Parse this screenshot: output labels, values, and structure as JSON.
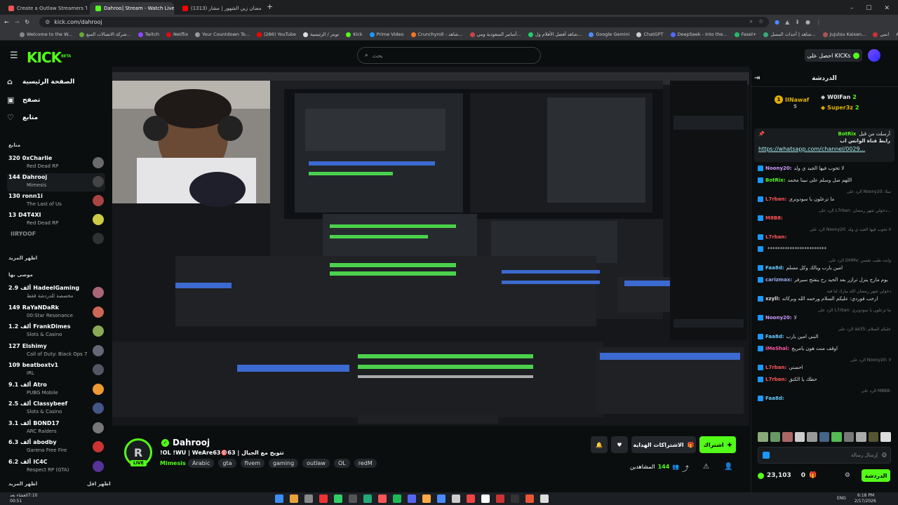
{
  "browser": {
    "tabs": [
      {
        "title": "Create a Outlaw Streamers Tier",
        "color": "#e55",
        "active": false
      },
      {
        "title": "Dahroo] Stream - Watch Live o",
        "color": "#53fc18",
        "active": true
      },
      {
        "title": "(1313) رمضان زين الشهور | مشار",
        "color": "#ff0000",
        "active": false
      }
    ],
    "new_tab": "+",
    "url": "kick.com/dahrooj",
    "bookmarks": [
      {
        "label": "Welcome to the W...",
        "color": "#888"
      },
      {
        "label": "شركة الاتصالات السع...",
        "color": "#6a3"
      },
      {
        "label": "Twitch",
        "color": "#9146ff"
      },
      {
        "label": "Netflix",
        "color": "#e50914"
      },
      {
        "label": "Your Countdown To...",
        "color": "#999"
      },
      {
        "label": "(286) YouTube",
        "color": "#ff0000"
      },
      {
        "label": "تويتر / الرئيسية",
        "color": "#ddd"
      },
      {
        "label": "Kick",
        "color": "#53fc18"
      },
      {
        "label": "Prime Video",
        "color": "#1a98ff"
      },
      {
        "label": "Crunchyroll - شاهد...",
        "color": "#f47521"
      },
      {
        "label": "أساتير السعودية ومي...",
        "color": "#c44"
      },
      {
        "label": "شاهد أفضل الأفلام ول...",
        "color": "#2c6"
      },
      {
        "label": "Google Gemini",
        "color": "#4a8cff"
      },
      {
        "label": "ChatGPT",
        "color": "#ccc"
      },
      {
        "label": "DeepSeek - Into the...",
        "color": "#4d6bfe"
      },
      {
        "label": "Fasel+",
        "color": "#2b6"
      },
      {
        "label": "شاهد | أحداث المسل...",
        "color": "#3a7"
      },
      {
        "label": "Jujutsu Kaisen...",
        "color": "#a55"
      },
      {
        "label": "انمي",
        "color": "#c33"
      }
    ],
    "all_bookmarks": "All Bookmarks"
  },
  "header": {
    "logo": "KICK",
    "logo_beta": "BETA",
    "search_placeholder": "بحث",
    "get_kicks": "احصل على KICKs"
  },
  "sidebar": {
    "nav": [
      {
        "label": "الصفحة الرئيسية",
        "icon": "home-icon"
      },
      {
        "label": "تصفح",
        "icon": "browse-icon"
      },
      {
        "label": "متابع",
        "icon": "heart-icon"
      }
    ],
    "following_header": "متابع",
    "following": [
      {
        "viewers": "320",
        "name": "0xCharlie",
        "game": "Red Dead RP",
        "color": "#6b6b6b"
      },
      {
        "viewers": "144",
        "name": "Dahrooj",
        "game": "Mimesis",
        "color": "#444"
      },
      {
        "viewers": "130",
        "name": "ronn1i",
        "game": "The Last of Us",
        "color": "#a44"
      },
      {
        "viewers": "13",
        "name": "D4T4XI",
        "game": "Red Dead RP",
        "color": "#cc4"
      },
      {
        "viewers": "",
        "name": "IIRYOOF",
        "game": "",
        "color": "#555"
      }
    ],
    "show_more_1": "اظهر المزيد",
    "recommended_header": "موصى بها",
    "recommended": [
      {
        "viewers": "2.9 ألف",
        "name": "HadeelGaming",
        "game": "مخصصة للدردشة فقط",
        "color": "#a67"
      },
      {
        "viewers": "149",
        "name": "RaYaNDaRk",
        "game": "00:Star Resonance",
        "color": "#c65"
      },
      {
        "viewers": "1.2 ألف",
        "name": "FrankDimes",
        "game": "Slots & Casino",
        "color": "#8a5"
      },
      {
        "viewers": "127",
        "name": "Elshimy",
        "game": "Call of Duty: Black Ops 7",
        "color": "#667"
      },
      {
        "viewers": "109",
        "name": "beatboxtv1",
        "game": "IRL",
        "color": "#556"
      },
      {
        "viewers": "9.1 ألف",
        "name": "Atro",
        "game": "PUBG Mobile",
        "color": "#e93"
      },
      {
        "viewers": "2.5 ألف",
        "name": "Classybeef",
        "game": "Slots & Casino",
        "color": "#458"
      },
      {
        "viewers": "3.1 ألف",
        "name": "BOND17",
        "game": "ARC Raiders",
        "color": "#777"
      },
      {
        "viewers": "6.3 ألف",
        "name": "abodby",
        "game": "Garena Free Fire",
        "color": "#c33"
      },
      {
        "viewers": "6.2 ألف",
        "name": "IC4C",
        "game": "Respect RP (GTA)",
        "color": "#539"
      }
    ],
    "show_more_2": "اظهر المزيد",
    "show_less": "اظهر اقل"
  },
  "channel": {
    "name": "Dahrooj",
    "avatar_letter": "R",
    "live": "LIVE",
    "title": "!OL !WU | WeAre63🎯63 | تتويج مع الجيال",
    "category": "Mimesis",
    "tags": [
      "Arabic",
      "gta",
      "fivem",
      "gaming",
      "outlaw",
      "OL",
      "redM"
    ],
    "follow": "اشتراك",
    "gift_subs": "الاشتراكات الهداية",
    "viewers_count": "144",
    "viewers_label": "المشاهدين"
  },
  "chat": {
    "title": "الدردشة",
    "gifters": [
      {
        "name": "IINawaf",
        "count": "5"
      },
      {
        "name": "W0lFan",
        "count": "2"
      },
      {
        "name": "Super3z",
        "count": "2"
      }
    ],
    "pinned_by": "أرسلت من قبل",
    "pinned_user": "BotRix",
    "pinned_text": "رابط قناة الواتس اب",
    "pinned_link": "https://whatsapp.com/channel/0029...",
    "messages": [
      {
        "user": "Noony20:",
        "text": "لا تخوب فيها الجيد ي ولد",
        "color": "#c9f",
        "reply": ""
      },
      {
        "user": "BotRix:",
        "text": "اللهم صل وسلم على نبينا محمد",
        "color": "#53fc18",
        "reply": ""
      },
      {
        "user": "L7rban:",
        "text": "ما تزعلون يا سودونري",
        "color": "#f55",
        "reply": "الرد على Noony20: سلا"
      },
      {
        "user": "M8B8:",
        "text": "",
        "color": "#f55",
        "reply": "الرد على L7rban: دخولي شهر رمضان..."
      },
      {
        "user": "L7rban:",
        "text": "",
        "color": "#f55",
        "reply": "الرد على Noony20: لا تخوب فيها الجيد ي ولد"
      },
      {
        "user": "",
        "text": "************************",
        "color": "#ddd",
        "reply": ""
      },
      {
        "user": "Faa8d:",
        "text": "امين يارب ويالك وكل مسلم",
        "color": "#6cf",
        "reply": "الرد على DHMv: وانت طيب نفسي"
      },
      {
        "user": "carizmax:",
        "text": "يوم مارج ينزل ترازر بعد الحيد رح ينفتح سيرفر",
        "color": "#9ae",
        "reply": ""
      },
      {
        "user": "xzyll:",
        "text": "ارحب فوردي: عليكم السلام ورحمه الله وبركاته",
        "color": "#ddd",
        "reply": "دخولي شهر رمضان الله يبارك لنا فيه"
      },
      {
        "user": "Noony20:",
        "text": "لا",
        "color": "#c9f",
        "reply": "الرد على L7rban: ما تزعلون يا سودونري"
      },
      {
        "user": "Faa8d:",
        "text": "البني امين يارب",
        "color": "#6cf",
        "reply": "الرد على aa35: عليكم السلام"
      },
      {
        "user": "iMeShal:",
        "text": "اوقف منت هون يامريج",
        "color": "#f5a",
        "reply": ""
      },
      {
        "user": "L7rban:",
        "text": "احصتي",
        "color": "#f55",
        "reply": "الرد على Noony20: لا"
      },
      {
        "user": "L7rban:",
        "text": "حظك يا الكنق",
        "color": "#f55",
        "reply": ""
      },
      {
        "user": "Faa8d:",
        "text": "",
        "color": "#6cf",
        "reply": "الرد على M8B8:"
      }
    ],
    "input_placeholder": "إرسال رسالة",
    "kicks_balance": "23,103",
    "subs_count": "0",
    "send": "الدردشة"
  },
  "taskbar": {
    "weather_temp": "7:10",
    "weather_label": "العشاء بعد",
    "weather_time": "00:51",
    "lang": "ENG",
    "time": "6:18 PM",
    "date": "2/17/2026"
  },
  "colors": {
    "accent": "#53fc18",
    "bg": "#0b0e0f",
    "panel": "#191c1f"
  }
}
